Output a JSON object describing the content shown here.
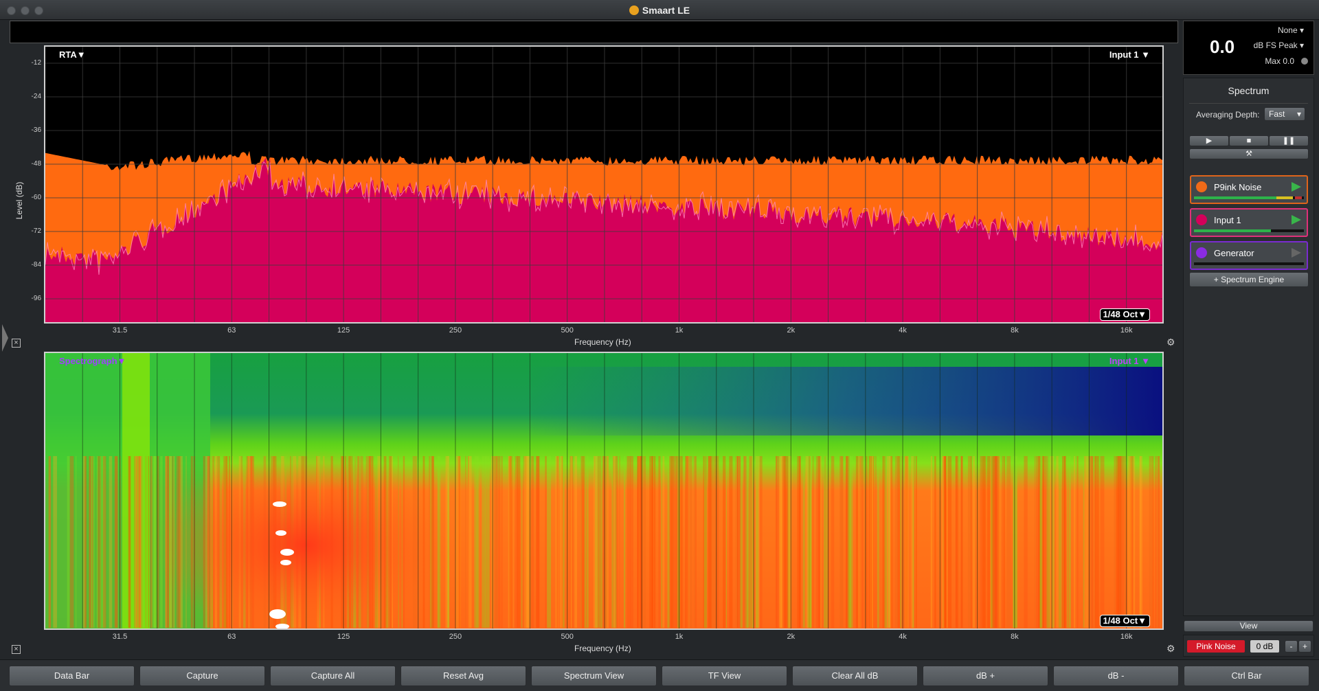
{
  "window": {
    "title": "Smaart LE"
  },
  "rta": {
    "mode_label": "RTA▼",
    "input_label": "Input 1 ▼",
    "resolution": "1/48 Oct▼",
    "ylabel": "Level (dB)",
    "xlabel": "Frequency (Hz)",
    "yticks": [
      "-12",
      "-24",
      "-36",
      "-48",
      "-60",
      "-72",
      "-84",
      "-96"
    ],
    "xticks": [
      "31.5",
      "63",
      "125",
      "250",
      "500",
      "1k",
      "2k",
      "4k",
      "8k",
      "16k"
    ],
    "colors": {
      "pink_noise": "#ff6a10",
      "input": "#d4005a",
      "trace": "#ff88c0"
    }
  },
  "spectrograph": {
    "mode_label": "Spectrograph▼",
    "input_label": "Input 1 ▼",
    "resolution": "1/48 Oct▼",
    "xlabel": "Frequency (Hz)",
    "xticks": [
      "31.5",
      "63",
      "125",
      "250",
      "500",
      "1k",
      "2k",
      "4k",
      "8k",
      "16k"
    ]
  },
  "meter": {
    "value": "0.0",
    "source": "None",
    "mode": "dB FS Peak",
    "max": "Max 0.0"
  },
  "spectrum_panel": {
    "title": "Spectrum",
    "avg_label": "Averaging Depth:",
    "avg_value": "Fast",
    "sources": [
      {
        "name": "P9ink Noise",
        "color": "#f06a18",
        "border": "#e0641a"
      },
      {
        "name": "Input 1",
        "color": "#d4005a",
        "border": "#e0307a"
      },
      {
        "name": "Generator",
        "color": "#8a2be2",
        "border": "#7a2bd0"
      }
    ],
    "add_engine": "+ Spectrum Engine"
  },
  "view": {
    "label": "View",
    "pink_noise": "Pink Noise",
    "gain": "0 dB",
    "minus": "-",
    "plus": "+"
  },
  "bottom_buttons": [
    "Data Bar",
    "Capture",
    "Capture All",
    "Reset Avg",
    "Spectrum View",
    "TF View",
    "Clear All dB",
    "dB +",
    "dB -",
    "Ctrl Bar"
  ]
}
